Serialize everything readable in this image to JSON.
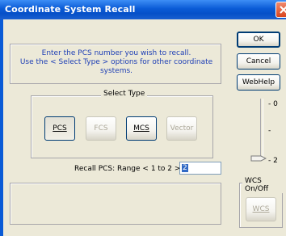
{
  "window": {
    "title": "Coordinate System Recall"
  },
  "instruction": {
    "line1": "Enter the PCS number you wish to recall.",
    "line2": "Use the < Select Type > options for other coordinate",
    "line3": "systems."
  },
  "select_type": {
    "legend": "Select Type",
    "buttons": [
      {
        "label": "PCS",
        "enabled": true,
        "pressed": true
      },
      {
        "label": "FCS",
        "enabled": false
      },
      {
        "label": "MCS",
        "enabled": true
      },
      {
        "label": "Vector",
        "enabled": false
      }
    ]
  },
  "recall": {
    "label": "Recall PCS: Range < 1 to 2 > :",
    "value": "2"
  },
  "side_buttons": {
    "ok": "OK",
    "cancel": "Cancel",
    "webhelp": "WebHelp"
  },
  "slider": {
    "top_tick": "0",
    "mid_tick": "-",
    "bottom_tick": "2",
    "value": 2,
    "min": 0,
    "max": 2
  },
  "wcs": {
    "legend": "WCS On/Off",
    "button": "WCS"
  }
}
